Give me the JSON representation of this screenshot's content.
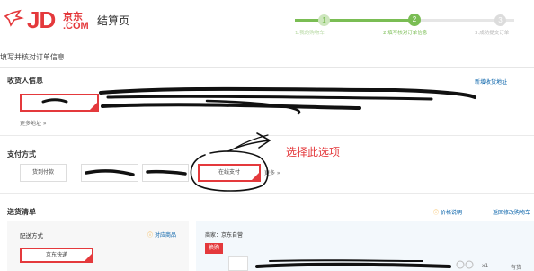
{
  "header": {
    "logo": {
      "jd": "JD",
      "cn": "京东",
      "com": ".COM"
    },
    "page_title": "结算页",
    "steps": [
      {
        "num": "1",
        "label": "1.我的购物车"
      },
      {
        "num": "2",
        "label": "2.填写核对订单信息"
      },
      {
        "num": "3",
        "label": "3.成功提交订单"
      }
    ]
  },
  "section_heading": "填写并核对订单信息",
  "consignee": {
    "title": "收货人信息",
    "add_link": "新增收货地址",
    "more": "更多地址 »"
  },
  "payment": {
    "title": "支付方式",
    "options": [
      "货到付款",
      "",
      "",
      "在线支付"
    ],
    "selected_index": 3,
    "more": "更多 »"
  },
  "annotation": "选择此选项",
  "shipping": {
    "title": "送货清单",
    "price_note": "价格说明",
    "back_to_cart": "返回修改购物车",
    "method_label": "配送方式",
    "support_link": "对应商品",
    "method_value": "京东快递",
    "merchant": "商家：京东自营",
    "badge": "换购",
    "quantity": "x1",
    "stock": "有货"
  },
  "colors": {
    "brand": "#e4393c",
    "step_done": "#7abd54",
    "link": "#005ea7"
  }
}
